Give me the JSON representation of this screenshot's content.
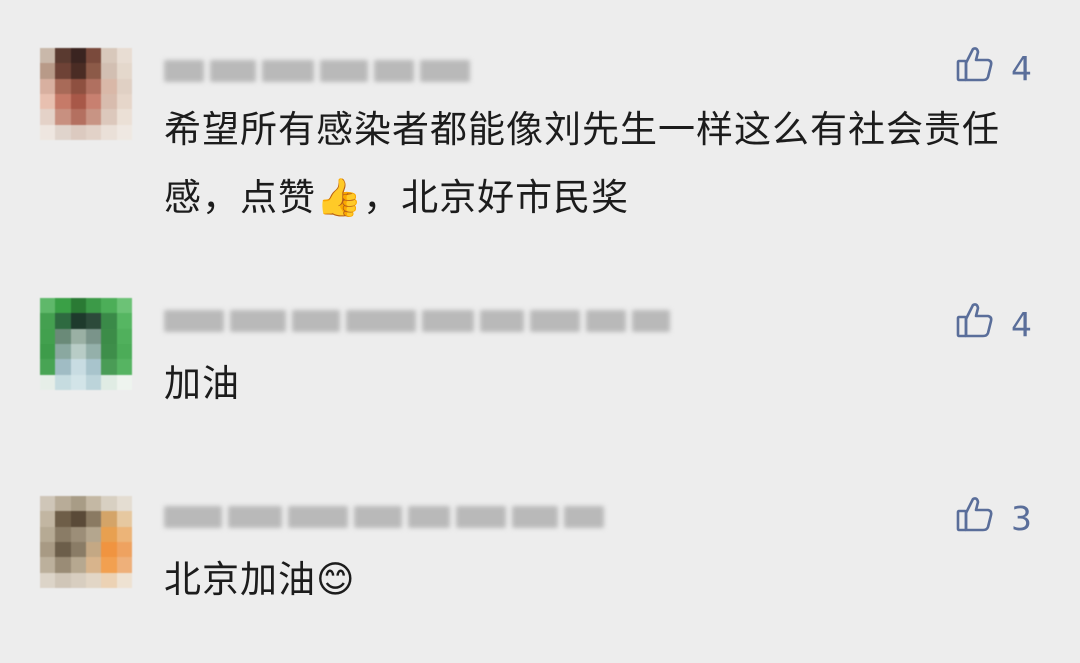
{
  "comments": [
    {
      "text": "希望所有感染者都能像刘先生一样这么有社会责任感，点赞👍，北京好市民奖",
      "likes": "4"
    },
    {
      "text": "加油",
      "likes": "4"
    },
    {
      "text": "北京加油😊",
      "likes": "3"
    }
  ],
  "icons": {
    "like": "thumbs-up-outline-icon"
  },
  "colors": {
    "background": "#ededed",
    "like_accent": "#5a6e9a",
    "text": "#1c1c1c"
  }
}
